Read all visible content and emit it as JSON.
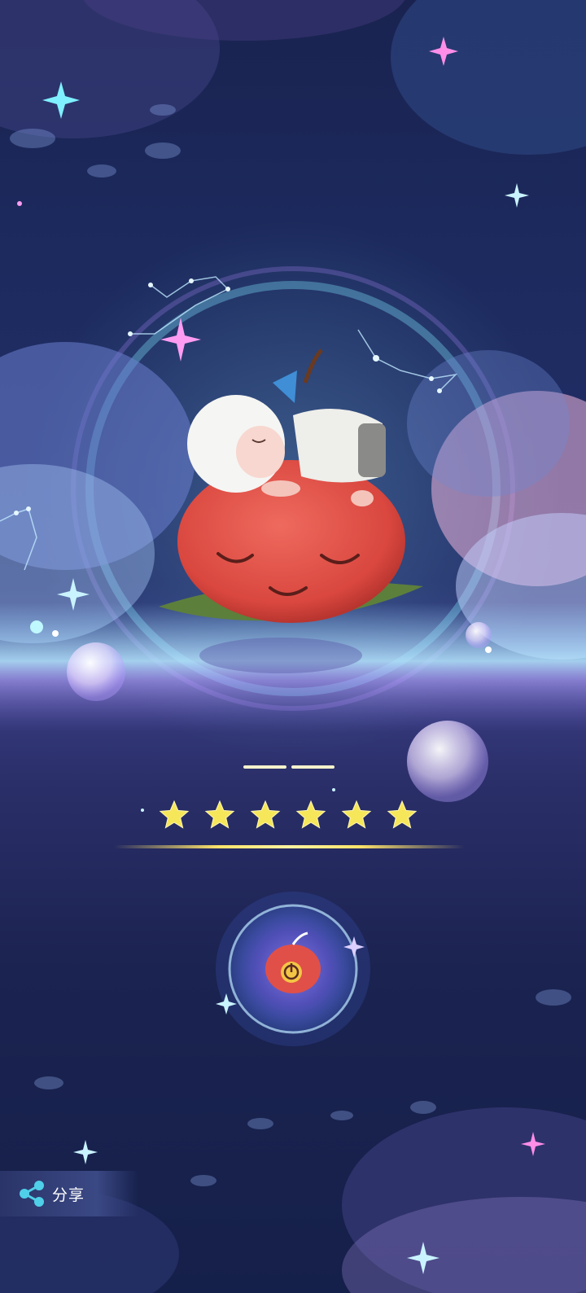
{
  "share": {
    "label": "分享",
    "icon": "share-icon"
  },
  "rating": {
    "stars": 6,
    "max": 6
  },
  "character": {
    "name": ""
  },
  "colors": {
    "apple": "#e2524a",
    "star": "#f6e65a",
    "accent_line": "#ffe46a"
  }
}
